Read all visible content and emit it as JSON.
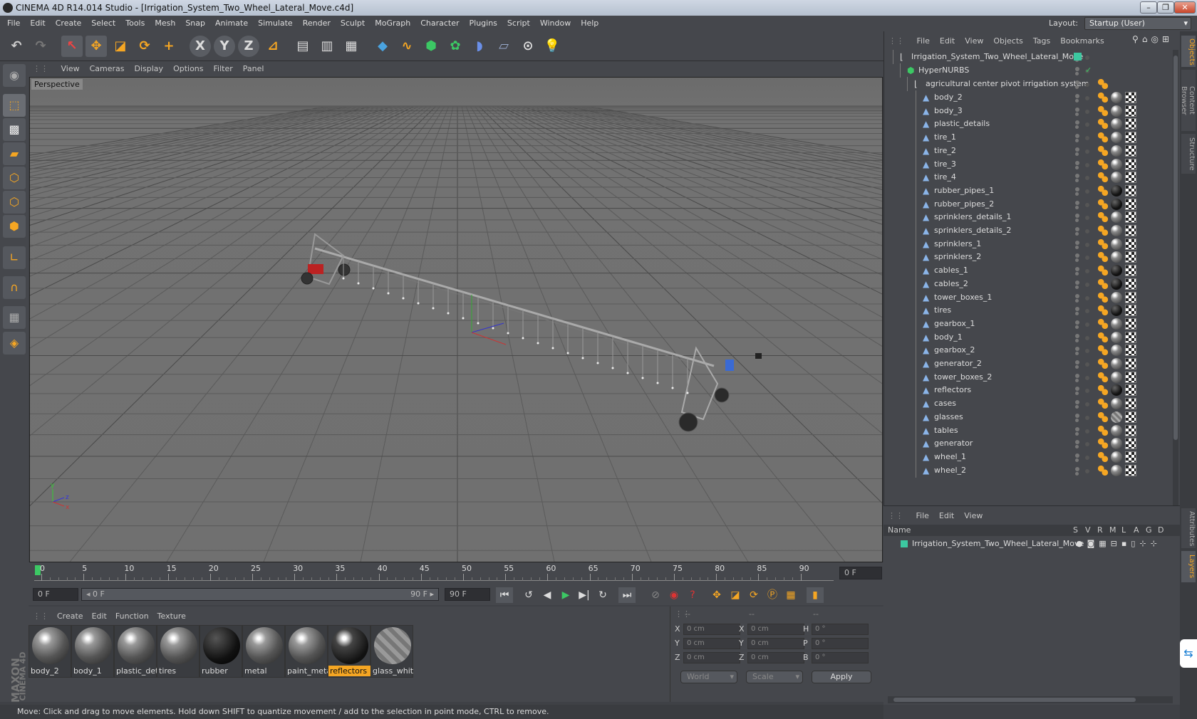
{
  "window": {
    "title": "CINEMA 4D R14.014 Studio - [Irrigation_System_Two_Wheel_Lateral_Move.c4d]"
  },
  "menu": [
    "File",
    "Edit",
    "Create",
    "Select",
    "Tools",
    "Mesh",
    "Snap",
    "Animate",
    "Simulate",
    "Render",
    "Sculpt",
    "MoGraph",
    "Character",
    "Plugins",
    "Script",
    "Window",
    "Help"
  ],
  "layout": {
    "label": "Layout:",
    "value": "Startup (User)"
  },
  "viewport": {
    "menu": [
      "View",
      "Cameras",
      "Display",
      "Options",
      "Filter",
      "Panel"
    ],
    "label": "Perspective"
  },
  "timeline": {
    "ticks": [
      "0",
      "5",
      "10",
      "15",
      "20",
      "25",
      "30",
      "35",
      "40",
      "45",
      "50",
      "55",
      "60",
      "65",
      "70",
      "75",
      "80",
      "85",
      "90"
    ],
    "frame_end": "0 F"
  },
  "transport": {
    "current": "0 F",
    "start": "0 F",
    "end_inner": "90 F",
    "end": "90 F"
  },
  "materials": {
    "menu": [
      "Create",
      "Edit",
      "Function",
      "Texture"
    ],
    "items": [
      "body_2",
      "body_1",
      "plastic_det",
      "tires",
      "rubber",
      "metal",
      "paint_meta",
      "reflectors",
      "glass_whit"
    ]
  },
  "coords": {
    "headers": [
      "--",
      "--",
      "--"
    ],
    "rows": [
      {
        "a": "X",
        "av": "0 cm",
        "b": "X",
        "bv": "0 cm",
        "c": "H",
        "cv": "0 °"
      },
      {
        "a": "Y",
        "av": "0 cm",
        "b": "Y",
        "bv": "0 cm",
        "c": "P",
        "cv": "0 °"
      },
      {
        "a": "Z",
        "av": "0 cm",
        "b": "Z",
        "bv": "0 cm",
        "c": "B",
        "cv": "0 °"
      }
    ],
    "world": "World",
    "scale": "Scale",
    "apply": "Apply"
  },
  "status": "Move: Click and drag to move elements. Hold down SHIFT to quantize movement / add to the selection in point mode, CTRL to remove.",
  "objects": {
    "menu": [
      "File",
      "Edit",
      "View",
      "Objects",
      "Tags",
      "Bookmarks"
    ],
    "root": "Irrigation_System_Two_Wheel_Lateral_Move",
    "hypernurbs": "HyperNURBS",
    "group": "agricultural center pivot irrigation system",
    "items": [
      "body_2",
      "body_3",
      "plastic_details",
      "tire_1",
      "tire_2",
      "tire_3",
      "tire_4",
      "rubber_pipes_1",
      "rubber_pipes_2",
      "sprinklers_details_1",
      "sprinklers_details_2",
      "sprinklers_1",
      "sprinklers_2",
      "cables_1",
      "cables_2",
      "tower_boxes_1",
      "tires",
      "gearbox_1",
      "body_1",
      "gearbox_2",
      "generator_2",
      "tower_boxes_2",
      "reflectors",
      "cases",
      "glasses",
      "tables",
      "generator",
      "wheel_1",
      "wheel_2"
    ]
  },
  "layers": {
    "menu": [
      "File",
      "Edit",
      "View"
    ],
    "name_header": "Name",
    "cols": [
      "S",
      "V",
      "R",
      "M",
      "L",
      "A",
      "G",
      "D"
    ],
    "row": "Irrigation_System_Two_Wheel_Lateral_Move"
  },
  "sidetabs": [
    "Objects",
    "Content Browser",
    "Structure",
    "Attributes",
    "Layers"
  ],
  "brand": [
    "MAXON",
    "CINEMA 4D"
  ]
}
